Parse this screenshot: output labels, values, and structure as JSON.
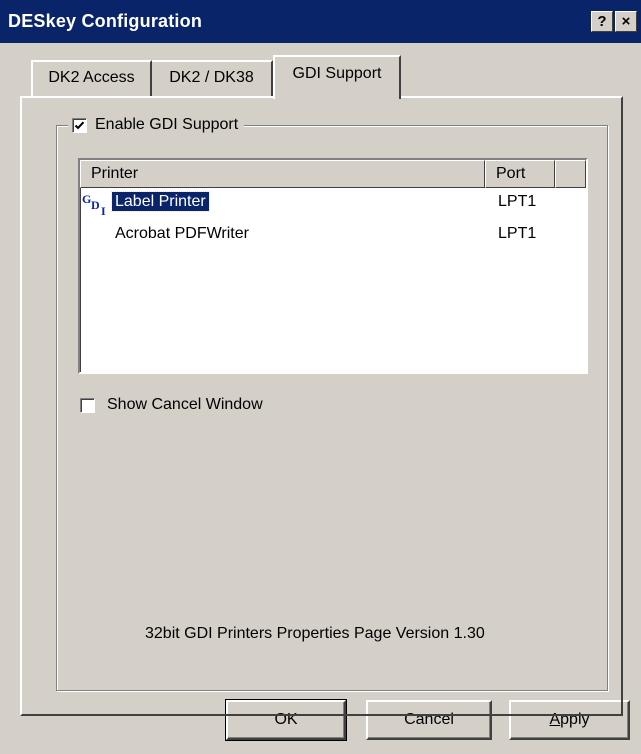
{
  "window": {
    "title": "DESkey Configuration",
    "help_button": "?",
    "close_button": "×"
  },
  "tabs": [
    {
      "label": "DK2 Access",
      "active": false
    },
    {
      "label": "DK2 / DK38",
      "active": false
    },
    {
      "label": "GDI Support",
      "active": true
    }
  ],
  "gdi": {
    "enable_label": "Enable GDI Support",
    "enable_checked": true,
    "columns": {
      "printer": "Printer",
      "port": "Port"
    },
    "printers": [
      {
        "name": "Label Printer",
        "port": "LPT1",
        "selected": true,
        "icon": "gdi-printer-icon"
      },
      {
        "name": "Acrobat PDFWriter",
        "port": "LPT1",
        "selected": false
      }
    ],
    "show_cancel_label": "Show Cancel Window",
    "show_cancel_checked": false,
    "version_text": "32bit GDI Printers Properties Page Version 1.30"
  },
  "buttons": {
    "ok": "OK",
    "cancel": "Cancel",
    "apply": "Apply"
  },
  "colors": {
    "title_bar": "#0a246a",
    "face": "#d4d0c8",
    "selection": "#0a246a"
  }
}
